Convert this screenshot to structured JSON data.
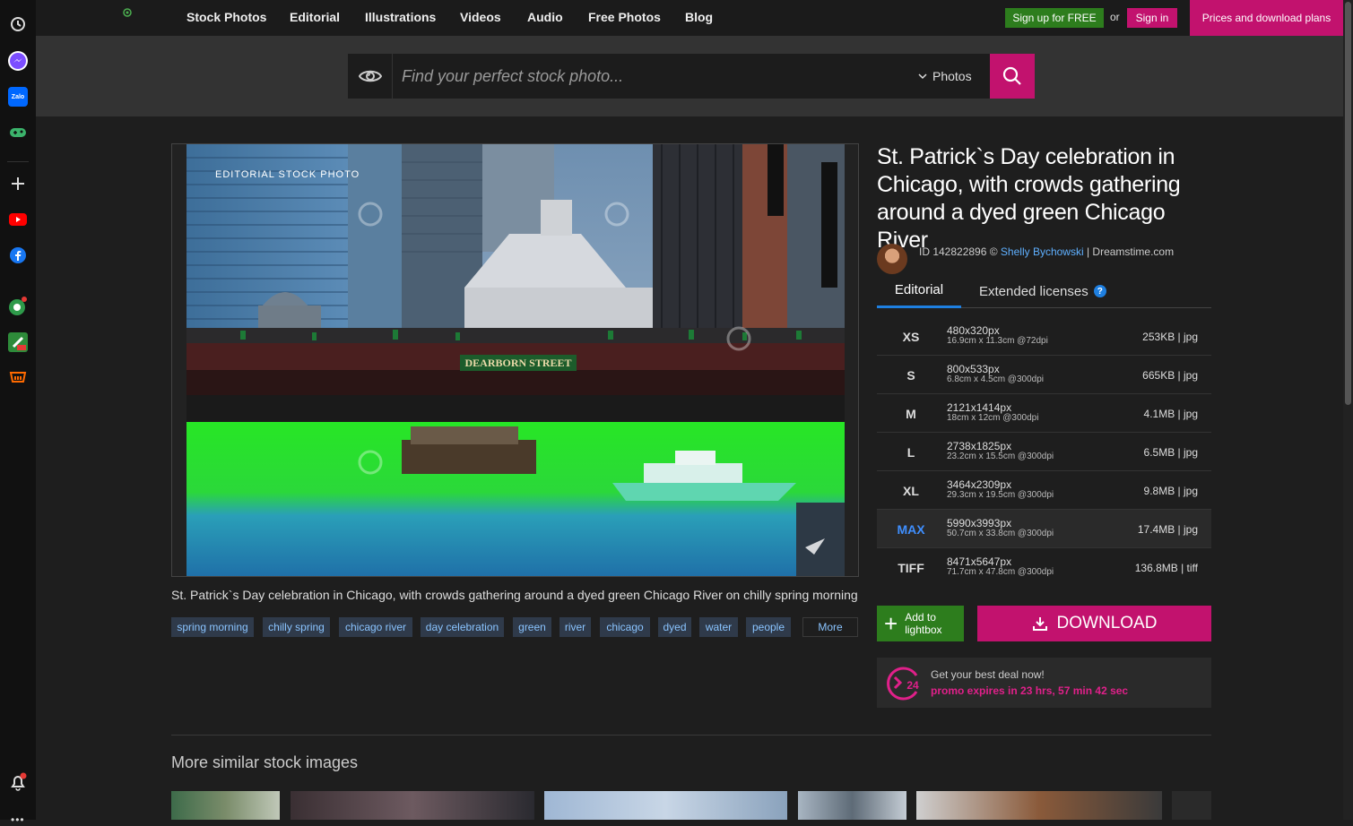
{
  "nav": [
    "Stock Photos",
    "Editorial",
    "Illustrations",
    "Videos",
    "Audio",
    "Free Photos",
    "Blog"
  ],
  "header": {
    "signup": "Sign up for FREE",
    "or": "or",
    "signin": "Sign in",
    "prices": "Prices and download plans"
  },
  "search": {
    "placeholder": "Find your perfect stock photo...",
    "category": "Photos"
  },
  "image": {
    "badge": "EDITORIAL STOCK PHOTO",
    "street_sign": "DEARBORN STREET",
    "caption": "St. Patrick`s Day celebration in Chicago, with crowds gathering around a dyed green Chicago River on chilly spring morning"
  },
  "tags": [
    "spring morning",
    "chilly spring",
    "chicago river",
    "day celebration",
    "green",
    "river",
    "chicago",
    "dyed",
    "water",
    "people"
  ],
  "more_label": "More",
  "details": {
    "title": "St. Patrick`s Day celebration in Chicago, with crowds gathering around a dyed green Chicago River",
    "id_prefix": "ID 142822896 ©",
    "author": "Shelly Bychowski",
    "site": "| Dreamstime.com",
    "tab_editorial": "Editorial",
    "tab_extended": "Extended licenses"
  },
  "sizes": [
    {
      "name": "XS",
      "px": "480x320px",
      "cm": "16.9cm x 11.3cm @72dpi",
      "file": "253KB | jpg"
    },
    {
      "name": "S",
      "px": "800x533px",
      "cm": "6.8cm x 4.5cm @300dpi",
      "file": "665KB | jpg"
    },
    {
      "name": "M",
      "px": "2121x1414px",
      "cm": "18cm x 12cm @300dpi",
      "file": "4.1MB | jpg"
    },
    {
      "name": "L",
      "px": "2738x1825px",
      "cm": "23.2cm x 15.5cm @300dpi",
      "file": "6.5MB | jpg"
    },
    {
      "name": "XL",
      "px": "3464x2309px",
      "cm": "29.3cm x 19.5cm @300dpi",
      "file": "9.8MB | jpg"
    },
    {
      "name": "MAX",
      "px": "5990x3993px",
      "cm": "50.7cm x 33.8cm @300dpi",
      "file": "17.4MB | jpg"
    },
    {
      "name": "TIFF",
      "px": "8471x5647px",
      "cm": "71.7cm x 47.8cm @300dpi",
      "file": "136.8MB | tiff"
    }
  ],
  "actions": {
    "lightbox": "Add to lightbox",
    "download": "DOWNLOAD"
  },
  "promo": {
    "line1": "Get your best deal now!",
    "line2": "promo expires in 23 hrs, 57 min 42 sec",
    "badge": "24"
  },
  "similar_title": "More similar stock images"
}
